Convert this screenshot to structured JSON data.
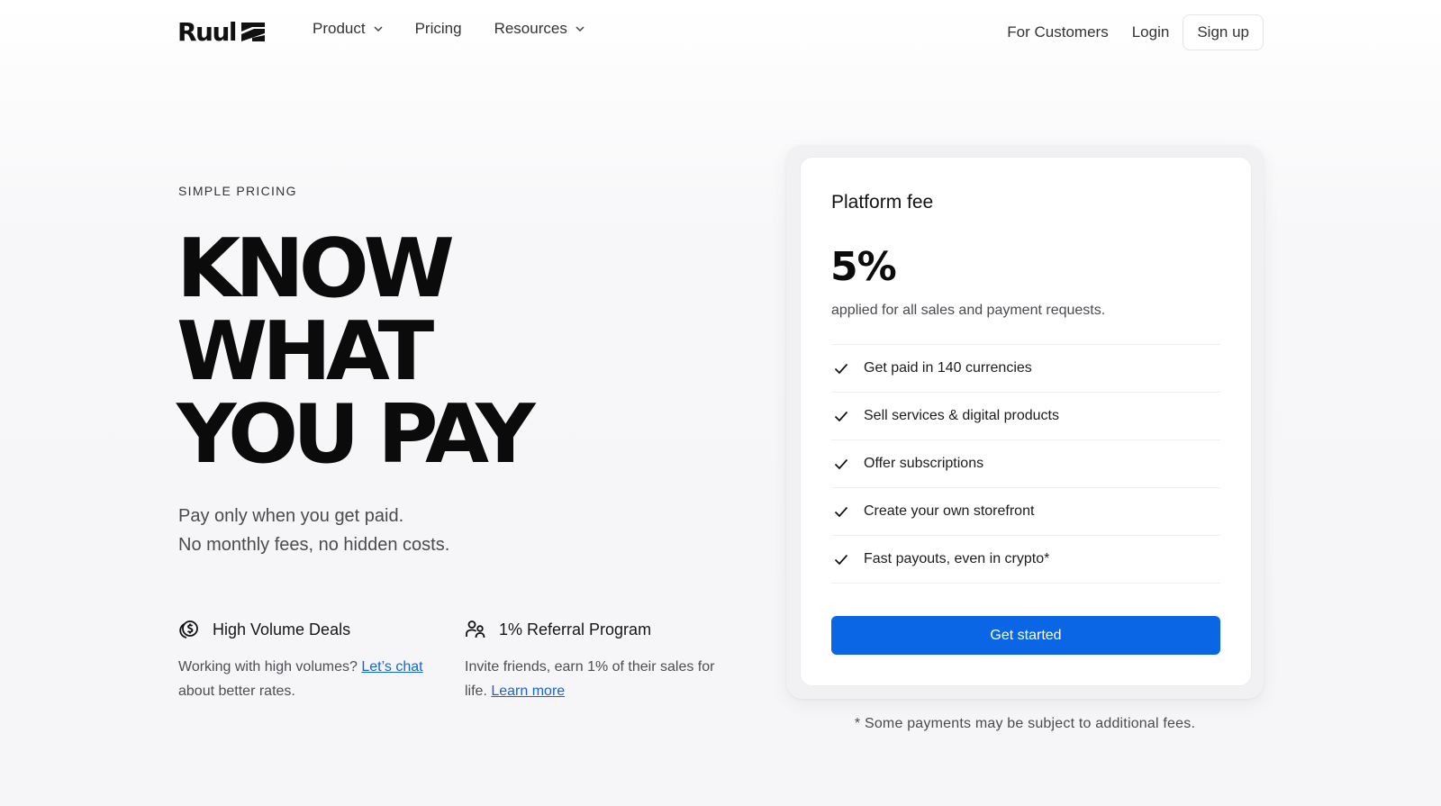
{
  "nav": {
    "logo_text": "Ruul",
    "links": [
      {
        "label": "Product",
        "has_dropdown": true
      },
      {
        "label": "Pricing",
        "has_dropdown": false
      },
      {
        "label": "Resources",
        "has_dropdown": true
      }
    ],
    "for_customers": "For Customers",
    "login": "Login",
    "signup": "Sign up"
  },
  "hero": {
    "eyebrow": "SIMPLE PRICING",
    "headline": [
      "KNOW",
      "WHAT",
      "YOU PAY"
    ],
    "subtitle_lines": [
      "Pay only when you get paid.",
      "No monthly fees, no hidden costs."
    ]
  },
  "features": [
    {
      "icon": "coins-icon",
      "title": "High Volume Deals",
      "text_before": "Working with high volumes?",
      "link": "Let’s chat",
      "text_after": "about better rates."
    },
    {
      "icon": "users-icon",
      "title": "1% Referral Program",
      "text_before": "Invite friends, earn 1% of their sales for life.",
      "link": "Learn more",
      "text_after": ""
    }
  ],
  "card": {
    "title": "Platform fee",
    "price": "5%",
    "description": "applied for all sales and payment requests.",
    "items": [
      "Get paid in 140 currencies",
      "Sell services & digital products",
      "Offer subscriptions",
      "Create your own storefront",
      "Fast payouts, even in crypto*"
    ],
    "cta": "Get started"
  },
  "footnote": "* Some payments may be subject to additional fees.",
  "colors": {
    "accent": "#0a66e4",
    "link": "#1364d8",
    "text": "#141414"
  }
}
